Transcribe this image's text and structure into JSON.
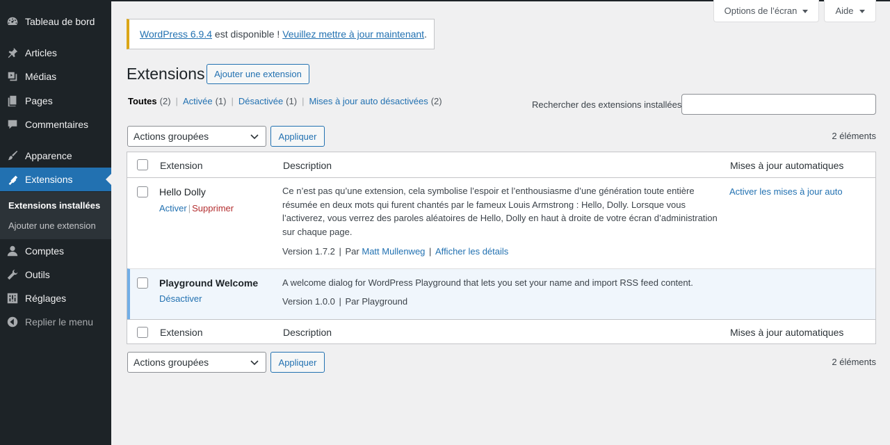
{
  "sidebar": {
    "items": [
      {
        "label": "Tableau de bord",
        "icon": "dashboard-icon"
      },
      {
        "label": "Articles",
        "icon": "pin-icon"
      },
      {
        "label": "Médias",
        "icon": "media-icon"
      },
      {
        "label": "Pages",
        "icon": "pages-icon"
      },
      {
        "label": "Commentaires",
        "icon": "comments-icon"
      },
      {
        "label": "Apparence",
        "icon": "brush-icon"
      },
      {
        "label": "Extensions",
        "icon": "plugins-icon"
      },
      {
        "label": "Comptes",
        "icon": "users-icon"
      },
      {
        "label": "Outils",
        "icon": "tools-icon"
      },
      {
        "label": "Réglages",
        "icon": "settings-icon"
      },
      {
        "label": "Replier le menu",
        "icon": "collapse-icon"
      }
    ],
    "submenu": [
      "Extensions installées",
      "Ajouter une extension"
    ]
  },
  "topbar": {
    "screen_options": "Options de l’écran",
    "help": "Aide"
  },
  "notice": {
    "link1": "WordPress 6.9.4",
    "middle": " est disponible ! ",
    "link2": "Veuillez mettre à jour maintenant",
    "end": "."
  },
  "page": {
    "title": "Extensions",
    "add_new": "Ajouter une extension"
  },
  "filters": [
    {
      "label": "Toutes",
      "count": "(2)"
    },
    {
      "label": "Activée",
      "count": "(1)"
    },
    {
      "label": "Désactivée",
      "count": "(1)"
    },
    {
      "label": "Mises à jour auto désactivées",
      "count": "(2)"
    }
  ],
  "search": {
    "label": "Rechercher des extensions installées",
    "value": ""
  },
  "bulk": {
    "select_label": "Actions groupées",
    "apply": "Appliquer",
    "count": "2 éléments"
  },
  "table": {
    "columns": [
      "Extension",
      "Description",
      "Mises à jour automatiques"
    ],
    "plugins": [
      {
        "name": "Hello Dolly",
        "actions": [
          "Activer",
          "Supprimer"
        ],
        "description": "Ce n’est pas qu’une extension, cela symbolise l’espoir et l’enthousiasme d’une génération toute entière résumée en deux mots qui furent chantés par le fameux Louis Armstrong : Hello, Dolly. Lorsque vous l’activerez, vous verrez des paroles aléatoires de Hello, Dolly en haut à droite de votre écran d’administration sur chaque page.",
        "version": "Version 1.7.2",
        "by": "Par",
        "author": "Matt Mullenweg",
        "details": "Afficher les détails",
        "auto_update": "Activer les mises à jour auto"
      },
      {
        "name": "Playground Welcome",
        "actions": [
          "Désactiver"
        ],
        "description": "A welcome dialog for WordPress Playground that lets you set your name and import RSS feed content.",
        "version": "Version 1.0.0",
        "by": "Par Playground"
      }
    ]
  },
  "colors": {
    "sidebar_bg": "#1d2327",
    "accent": "#2271b1",
    "notice_border": "#dba617",
    "delete": "#b32d2e",
    "active_row_bg": "#f0f6fc"
  }
}
